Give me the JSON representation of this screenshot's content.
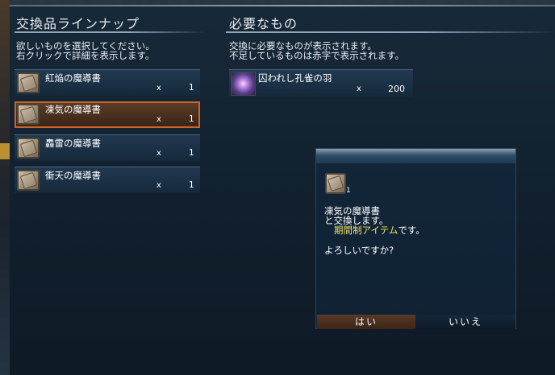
{
  "left_section": {
    "title": "交換品ラインナップ",
    "instructions": [
      "欲しいものを選択してください。",
      "右クリックで詳細を表示します。"
    ],
    "items": [
      {
        "name": "紅焔の魔導書",
        "x": "x",
        "qty": "1",
        "selected": false
      },
      {
        "name": "凍気の魔導書",
        "x": "x",
        "qty": "1",
        "selected": true
      },
      {
        "name": "轟雷の魔導書",
        "x": "x",
        "qty": "1",
        "selected": false
      },
      {
        "name": "衝天の魔導書",
        "x": "x",
        "qty": "1",
        "selected": false
      }
    ]
  },
  "right_section": {
    "title": "必要なもの",
    "instructions": [
      "交換に必要なものが表示されます。",
      "不足しているものは赤字で表示されます。"
    ],
    "required": {
      "name": "囚われし孔雀の羽",
      "x": "x",
      "qty": "200",
      "icon": "feather-icon"
    }
  },
  "dialog": {
    "icon_qty": "1",
    "line1": "凍気の魔導書",
    "line2": "と交換します。",
    "line3_highlight": "期間制アイテム",
    "line3_rest": "です。",
    "question": "よろしいですか?",
    "yes_label": "はい",
    "no_label": "いいえ"
  },
  "colors": {
    "accent_selected": "#c6662a",
    "highlight_text": "#f0e46a"
  }
}
